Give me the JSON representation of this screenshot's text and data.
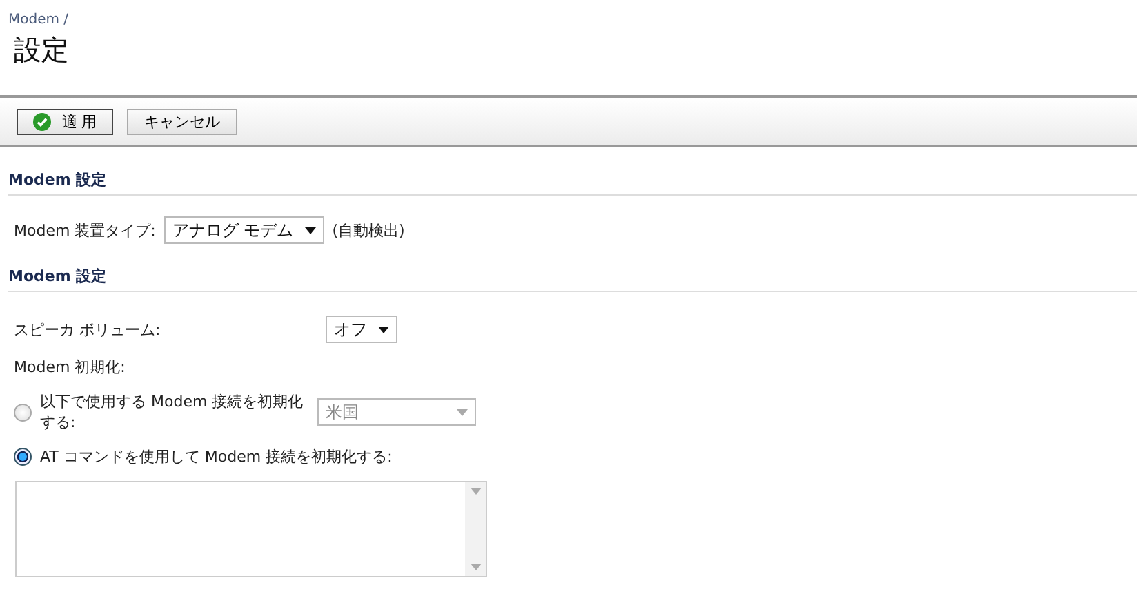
{
  "breadcrumb": "Modem /",
  "title": "設定",
  "toolbar": [
    {
      "label": "適 用",
      "kind": "apply"
    },
    {
      "label": "キャンセル",
      "kind": "plain"
    }
  ],
  "device_section": {
    "title": "Modem 設定",
    "label": "Modem 装置タイプ:",
    "select": "アナログ モデム",
    "note": "(自動検出)"
  },
  "modem_section": {
    "title": "Modem 設定",
    "speaker_label": "スピーカ ボリューム:",
    "speaker_select": "オフ",
    "init_label": "Modem 初期化:",
    "options": [
      {
        "label": "以下で使用する Modem 接続を初期化する:",
        "selected": false,
        "select": "米国",
        "disabled": true
      },
      {
        "label": "AT コマンドを使用して Modem 接続を初期化する:",
        "selected": true
      }
    ]
  }
}
